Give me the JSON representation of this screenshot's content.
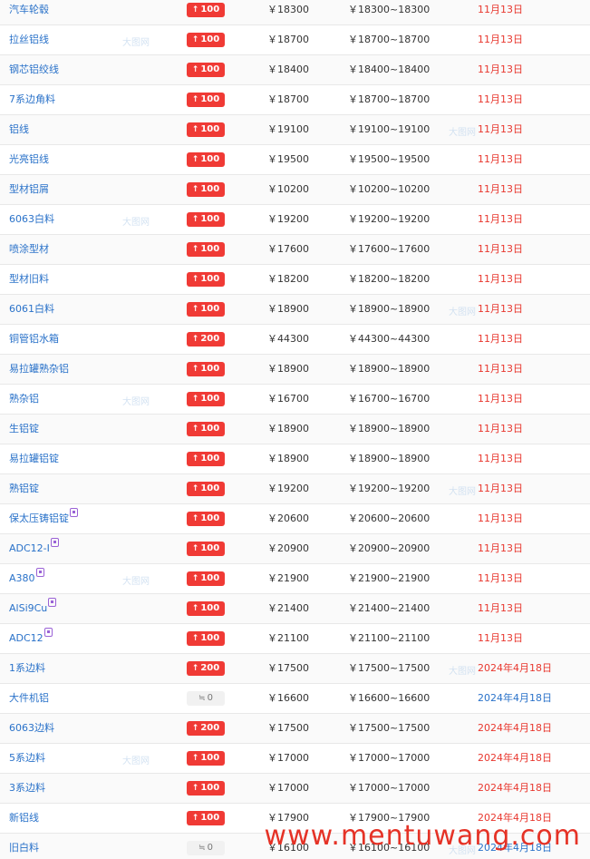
{
  "colors": {
    "link": "#2a72c9",
    "up_badge": "#f03a35",
    "flat_badge": "#f1f1f1",
    "date_red": "#e8372e",
    "date_blue": "#2a72c9",
    "watermark": "#e53226"
  },
  "icons": {
    "up": "up-arrow-icon",
    "flat": "flat-change-icon",
    "tag": "hot-tag-icon"
  },
  "rows": [
    {
      "name": "汽车轮毂",
      "tag": false,
      "change": "100",
      "direction": "up",
      "price": "￥18300",
      "range": "￥18300~18300",
      "date": "11月13日",
      "date_color": "red"
    },
    {
      "name": "拉丝铝线",
      "tag": false,
      "change": "100",
      "direction": "up",
      "price": "￥18700",
      "range": "￥18700~18700",
      "date": "11月13日",
      "date_color": "red"
    },
    {
      "name": "钢芯铝绞线",
      "tag": false,
      "change": "100",
      "direction": "up",
      "price": "￥18400",
      "range": "￥18400~18400",
      "date": "11月13日",
      "date_color": "red"
    },
    {
      "name": "7系边角料",
      "tag": false,
      "change": "100",
      "direction": "up",
      "price": "￥18700",
      "range": "￥18700~18700",
      "date": "11月13日",
      "date_color": "red"
    },
    {
      "name": "铝线",
      "tag": false,
      "change": "100",
      "direction": "up",
      "price": "￥19100",
      "range": "￥19100~19100",
      "date": "11月13日",
      "date_color": "red"
    },
    {
      "name": "光亮铝线",
      "tag": false,
      "change": "100",
      "direction": "up",
      "price": "￥19500",
      "range": "￥19500~19500",
      "date": "11月13日",
      "date_color": "red"
    },
    {
      "name": "型材铝屑",
      "tag": false,
      "change": "100",
      "direction": "up",
      "price": "￥10200",
      "range": "￥10200~10200",
      "date": "11月13日",
      "date_color": "red"
    },
    {
      "name": "6063白料",
      "tag": false,
      "change": "100",
      "direction": "up",
      "price": "￥19200",
      "range": "￥19200~19200",
      "date": "11月13日",
      "date_color": "red"
    },
    {
      "name": "喷涂型材",
      "tag": false,
      "change": "100",
      "direction": "up",
      "price": "￥17600",
      "range": "￥17600~17600",
      "date": "11月13日",
      "date_color": "red"
    },
    {
      "name": "型材旧料",
      "tag": false,
      "change": "100",
      "direction": "up",
      "price": "￥18200",
      "range": "￥18200~18200",
      "date": "11月13日",
      "date_color": "red"
    },
    {
      "name": "6061白料",
      "tag": false,
      "change": "100",
      "direction": "up",
      "price": "￥18900",
      "range": "￥18900~18900",
      "date": "11月13日",
      "date_color": "red"
    },
    {
      "name": "铜管铝水箱",
      "tag": false,
      "change": "200",
      "direction": "up",
      "price": "￥44300",
      "range": "￥44300~44300",
      "date": "11月13日",
      "date_color": "red"
    },
    {
      "name": "易拉罐熟杂铝",
      "tag": false,
      "change": "100",
      "direction": "up",
      "price": "￥18900",
      "range": "￥18900~18900",
      "date": "11月13日",
      "date_color": "red"
    },
    {
      "name": "熟杂铝",
      "tag": false,
      "change": "100",
      "direction": "up",
      "price": "￥16700",
      "range": "￥16700~16700",
      "date": "11月13日",
      "date_color": "red"
    },
    {
      "name": "生铝锭",
      "tag": false,
      "change": "100",
      "direction": "up",
      "price": "￥18900",
      "range": "￥18900~18900",
      "date": "11月13日",
      "date_color": "red"
    },
    {
      "name": "易拉罐铝锭",
      "tag": false,
      "change": "100",
      "direction": "up",
      "price": "￥18900",
      "range": "￥18900~18900",
      "date": "11月13日",
      "date_color": "red"
    },
    {
      "name": "熟铝锭",
      "tag": false,
      "change": "100",
      "direction": "up",
      "price": "￥19200",
      "range": "￥19200~19200",
      "date": "11月13日",
      "date_color": "red"
    },
    {
      "name": "保太压铸铝锭",
      "tag": true,
      "change": "100",
      "direction": "up",
      "price": "￥20600",
      "range": "￥20600~20600",
      "date": "11月13日",
      "date_color": "red"
    },
    {
      "name": "ADC12-Ⅰ",
      "tag": true,
      "change": "100",
      "direction": "up",
      "price": "￥20900",
      "range": "￥20900~20900",
      "date": "11月13日",
      "date_color": "red"
    },
    {
      "name": "A380",
      "tag": true,
      "change": "100",
      "direction": "up",
      "price": "￥21900",
      "range": "￥21900~21900",
      "date": "11月13日",
      "date_color": "red"
    },
    {
      "name": "AlSi9Cu",
      "tag": true,
      "change": "100",
      "direction": "up",
      "price": "￥21400",
      "range": "￥21400~21400",
      "date": "11月13日",
      "date_color": "red"
    },
    {
      "name": "ADC12",
      "tag": true,
      "change": "100",
      "direction": "up",
      "price": "￥21100",
      "range": "￥21100~21100",
      "date": "11月13日",
      "date_color": "red"
    },
    {
      "name": "1系边料",
      "tag": false,
      "change": "200",
      "direction": "up",
      "price": "￥17500",
      "range": "￥17500~17500",
      "date": "2024年4月18日",
      "date_color": "red"
    },
    {
      "name": "大件机铝",
      "tag": false,
      "change": "0",
      "direction": "flat",
      "price": "￥16600",
      "range": "￥16600~16600",
      "date": "2024年4月18日",
      "date_color": "blue"
    },
    {
      "name": "6063边料",
      "tag": false,
      "change": "200",
      "direction": "up",
      "price": "￥17500",
      "range": "￥17500~17500",
      "date": "2024年4月18日",
      "date_color": "red"
    },
    {
      "name": "5系边料",
      "tag": false,
      "change": "100",
      "direction": "up",
      "price": "￥17000",
      "range": "￥17000~17000",
      "date": "2024年4月18日",
      "date_color": "red"
    },
    {
      "name": "3系边料",
      "tag": false,
      "change": "100",
      "direction": "up",
      "price": "￥17000",
      "range": "￥17000~17000",
      "date": "2024年4月18日",
      "date_color": "red"
    },
    {
      "name": "新铝线",
      "tag": false,
      "change": "100",
      "direction": "up",
      "price": "￥17900",
      "range": "￥17900~17900",
      "date": "2024年4月18日",
      "date_color": "red"
    },
    {
      "name": "旧白料",
      "tag": false,
      "change": "0",
      "direction": "flat",
      "price": "￥16100",
      "range": "￥16100~16100",
      "date": "2024年4月18日",
      "date_color": "blue"
    }
  ],
  "site_watermark": "www.mentuwang.com",
  "row_watermark": "大图网"
}
